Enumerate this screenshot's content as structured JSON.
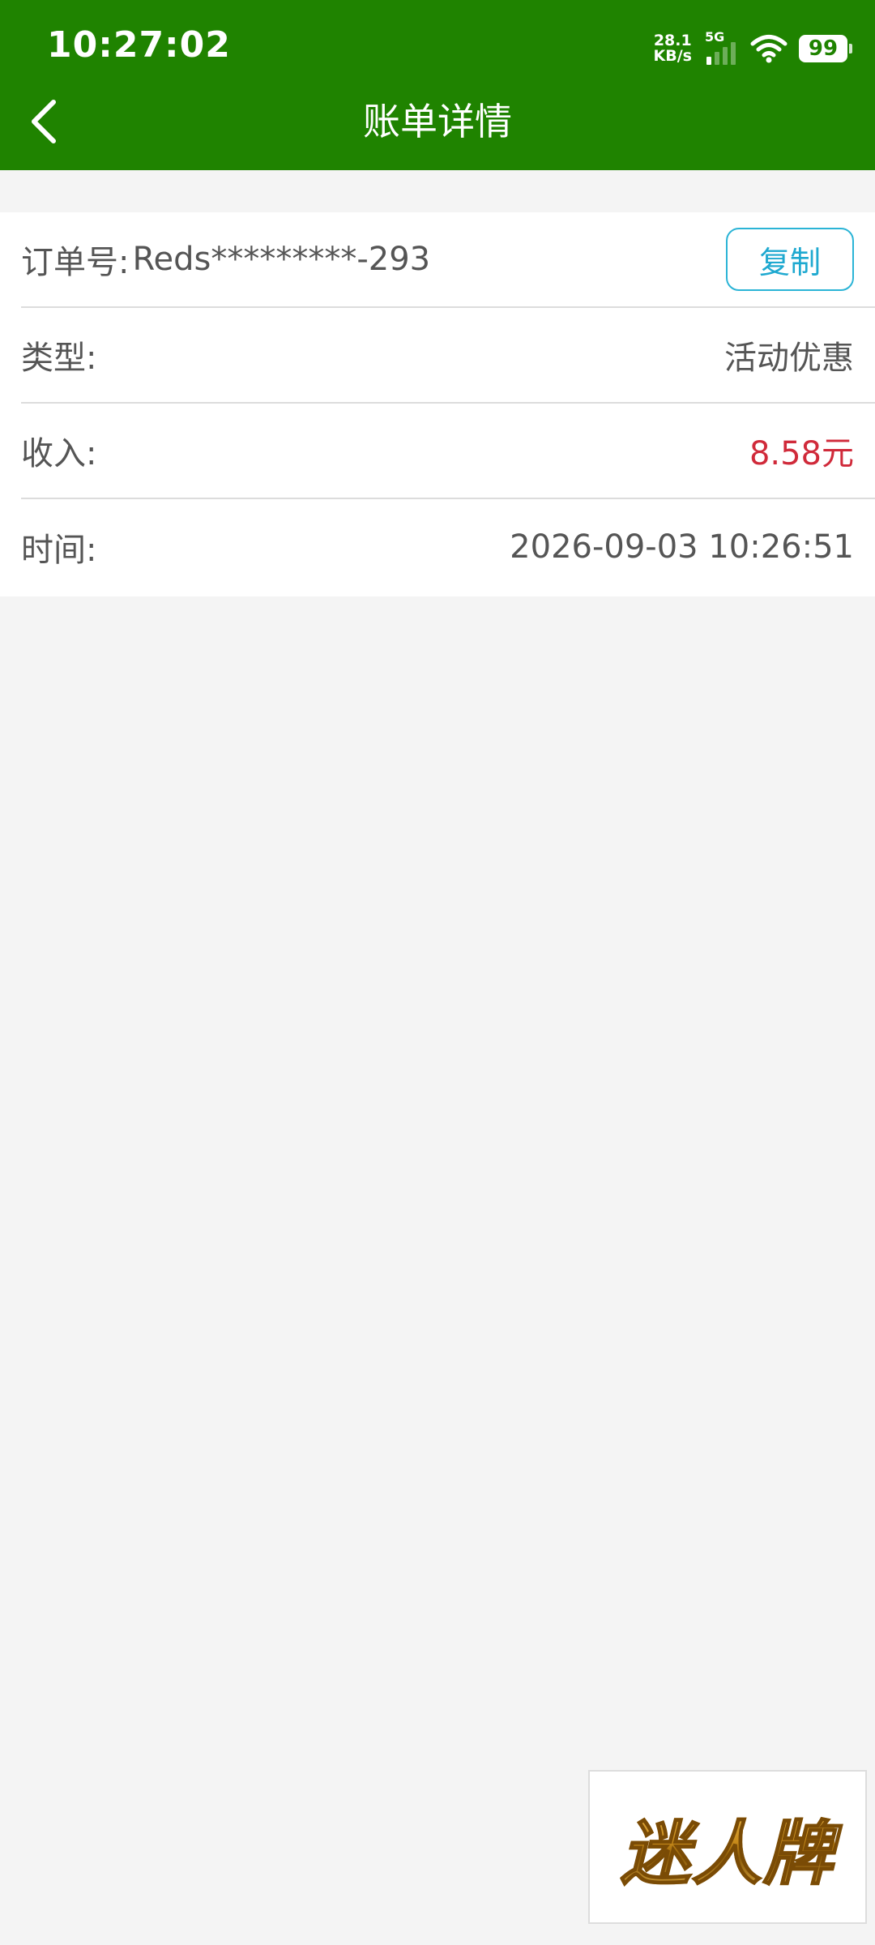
{
  "status_bar": {
    "time": "10:27:02",
    "net_speed_value": "28.1",
    "net_speed_unit": "KB/s",
    "network_type": "5G",
    "battery": "99",
    "wifi_icon": "wifi-icon",
    "signal_icon": "signal-bars-icon"
  },
  "header": {
    "title": "账单详情",
    "back_icon": "chevron-left-icon",
    "background_color": "#1f8300"
  },
  "details": {
    "order_label": "订单号:",
    "order_number": "Reds*********-293",
    "copy_label": "复制",
    "type_label": "类型:",
    "type_value": "活动优惠",
    "income_label": "收入:",
    "income_value": "8.58元",
    "time_label": "时间:",
    "time_value": "2026-09-03 10:26:51"
  },
  "colors": {
    "accent_green": "#1f8300",
    "income_red": "#d02a3a",
    "copy_button_blue": "#2bb4d6"
  },
  "ad": {
    "logo_text": "迷人牌"
  }
}
